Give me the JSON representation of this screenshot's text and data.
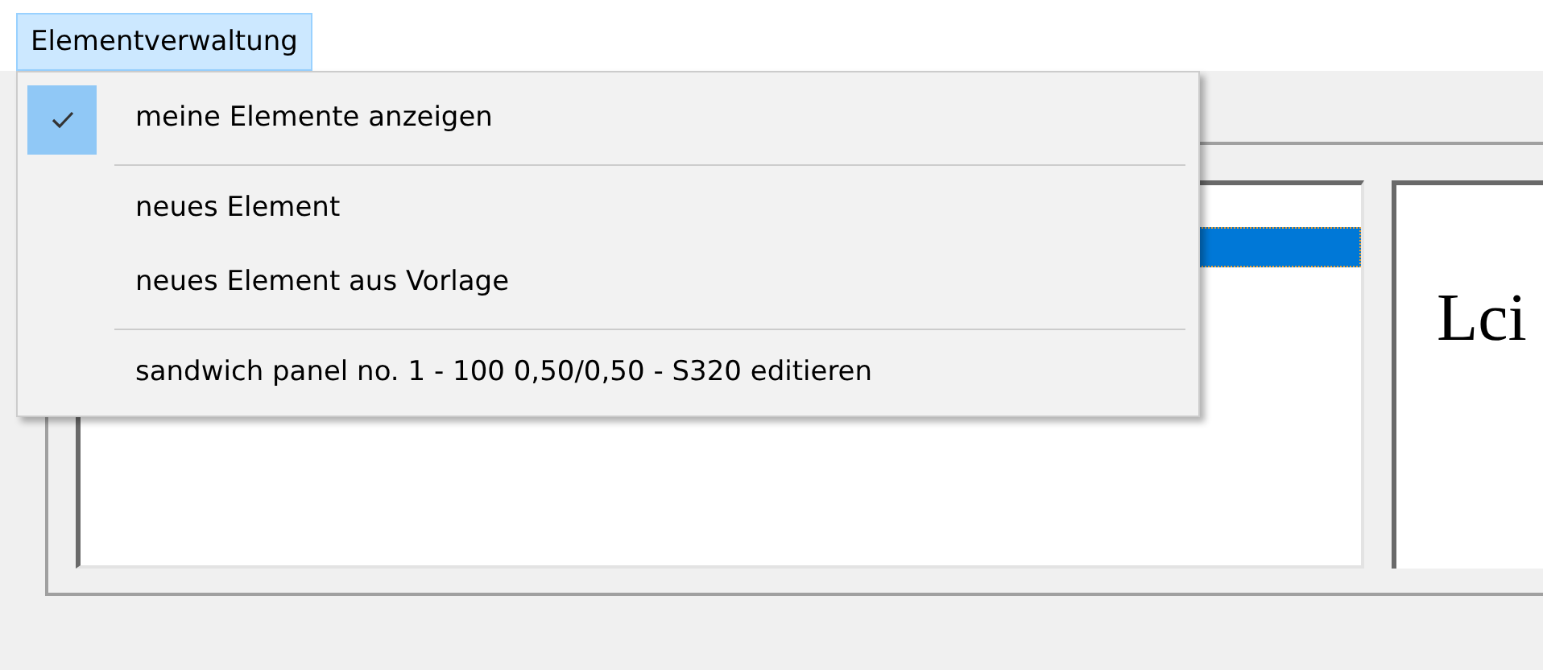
{
  "menu_bar": {
    "items": [
      {
        "label": "Elementverwaltung",
        "selected": true
      }
    ]
  },
  "dropdown": {
    "items": [
      {
        "kind": "check",
        "label": "meine Elemente anzeigen",
        "checked": true
      },
      {
        "kind": "separator"
      },
      {
        "kind": "command",
        "label": "neues Element"
      },
      {
        "kind": "command",
        "label": "neues Element aus Vorlage"
      },
      {
        "kind": "separator"
      },
      {
        "kind": "command",
        "label": "sandwich panel no. 1 - 100 0,50/0,50 - S320 editieren"
      }
    ]
  },
  "element_list": {
    "rows": [
      {
        "selected": true
      }
    ]
  },
  "preview": {
    "text": "Lci"
  }
}
